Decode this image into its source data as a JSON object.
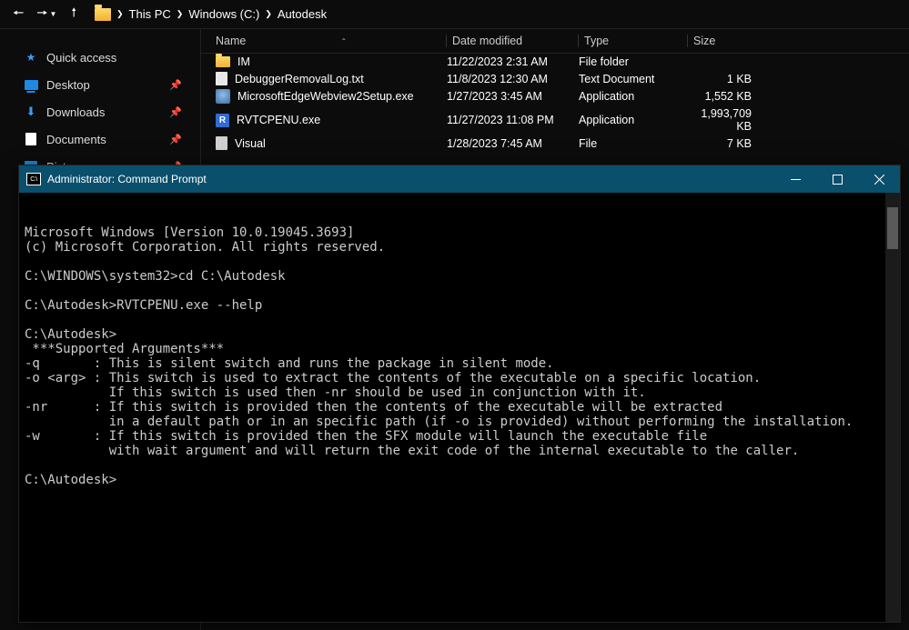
{
  "nav": {
    "breadcrumbs": [
      "This PC",
      "Windows (C:)",
      "Autodesk"
    ]
  },
  "sidebar": {
    "items": [
      {
        "label": "Quick access",
        "icon": "quick",
        "pinned": false
      },
      {
        "label": "Desktop",
        "icon": "desktop",
        "pinned": true
      },
      {
        "label": "Downloads",
        "icon": "downloads",
        "pinned": true
      },
      {
        "label": "Documents",
        "icon": "documents",
        "pinned": true
      },
      {
        "label": "Pictures",
        "icon": "pictures",
        "pinned": true
      }
    ]
  },
  "columns": {
    "name": "Name",
    "date": "Date modified",
    "type": "Type",
    "size": "Size"
  },
  "files": [
    {
      "name": "IM",
      "date": "11/22/2023 2:31 AM",
      "type": "File folder",
      "size": "",
      "icon": "folder"
    },
    {
      "name": "DebuggerRemovalLog.txt",
      "date": "11/8/2023 12:30 AM",
      "type": "Text Document",
      "size": "1 KB",
      "icon": "txt"
    },
    {
      "name": "MicrosoftEdgeWebview2Setup.exe",
      "date": "1/27/2023 3:45 AM",
      "type": "Application",
      "size": "1,552 KB",
      "icon": "exe"
    },
    {
      "name": "RVTCPENU.exe",
      "date": "11/27/2023 11:08 PM",
      "type": "Application",
      "size": "1,993,709 KB",
      "icon": "revit"
    },
    {
      "name": "Visual",
      "date": "1/28/2023 7:45 AM",
      "type": "File",
      "size": "7 KB",
      "icon": "file"
    }
  ],
  "cmd": {
    "title": "Administrator: Command Prompt",
    "lines": [
      "Microsoft Windows [Version 10.0.19045.3693]",
      "(c) Microsoft Corporation. All rights reserved.",
      "",
      "C:\\WINDOWS\\system32>cd C:\\Autodesk",
      "",
      "C:\\Autodesk>RVTCPENU.exe --help",
      "",
      "C:\\Autodesk>",
      " ***Supported Arguments***",
      "-q       : This is silent switch and runs the package in silent mode.",
      "-o <arg> : This switch is used to extract the contents of the executable on a specific location.",
      "           If this switch is used then -nr should be used in conjunction with it.",
      "-nr      : If this switch is provided then the contents of the executable will be extracted",
      "           in a default path or in an specific path (if -o is provided) without performing the installation.",
      "-w       : If this switch is provided then the SFX module will launch the executable file",
      "           with wait argument and will return the exit code of the internal executable to the caller.",
      "",
      "C:\\Autodesk>"
    ]
  }
}
